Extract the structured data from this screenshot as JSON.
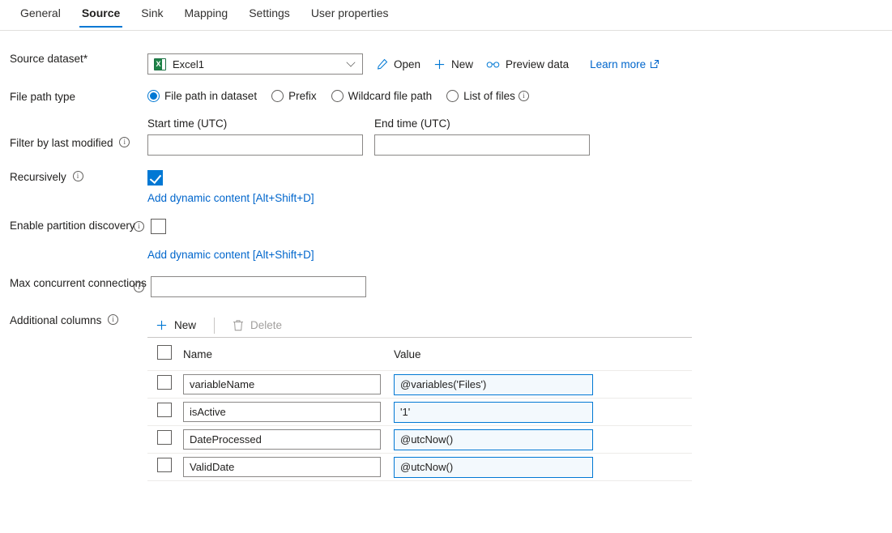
{
  "tabs": [
    {
      "label": "General",
      "active": false
    },
    {
      "label": "Source",
      "active": true
    },
    {
      "label": "Sink",
      "active": false
    },
    {
      "label": "Mapping",
      "active": false
    },
    {
      "label": "Settings",
      "active": false
    },
    {
      "label": "User properties",
      "active": false
    }
  ],
  "source_dataset": {
    "label": "Source dataset",
    "required_marker": "*",
    "value": "Excel1",
    "icon": "excel-icon",
    "commands": [
      {
        "label": "Open",
        "icon": "pencil-icon"
      },
      {
        "label": "New",
        "icon": "plus-icon"
      },
      {
        "label": "Preview data",
        "icon": "glasses-icon"
      }
    ],
    "learn_more": "Learn more"
  },
  "file_path_type": {
    "label": "File path type",
    "options": [
      {
        "label": "File path in dataset",
        "selected": true,
        "info": false
      },
      {
        "label": "Prefix",
        "selected": false,
        "info": false
      },
      {
        "label": "Wildcard file path",
        "selected": false,
        "info": false
      },
      {
        "label": "List of files",
        "selected": false,
        "info": true
      }
    ]
  },
  "filter_last_modified": {
    "label": "Filter by last modified",
    "start_label": "Start time (UTC)",
    "start_value": "",
    "end_label": "End time (UTC)",
    "end_value": ""
  },
  "recursively": {
    "label": "Recursively",
    "checked": true,
    "dynamic_link": "Add dynamic content [Alt+Shift+D]"
  },
  "partition_discovery": {
    "label": "Enable partition discovery",
    "checked": false,
    "dynamic_link": "Add dynamic content [Alt+Shift+D]"
  },
  "max_concurrent_connections": {
    "label": "Max concurrent connections",
    "value": ""
  },
  "additional_columns": {
    "label": "Additional columns",
    "new_label": "New",
    "delete_label": "Delete",
    "delete_disabled": true,
    "headers": {
      "name": "Name",
      "value": "Value"
    },
    "rows": [
      {
        "name": "variableName",
        "value": "@variables('Files')",
        "checked": false
      },
      {
        "name": "isActive",
        "value": "'1'",
        "checked": false
      },
      {
        "name": "DateProcessed",
        "value": "@utcNow()",
        "checked": false
      },
      {
        "name": "ValidDate",
        "value": "@utcNow()",
        "checked": false
      }
    ]
  },
  "colors": {
    "accent": "#0078d4",
    "link": "#0066cc",
    "excel_green": "#1d8247",
    "border": "#8a8886",
    "row_divider": "#edebe9"
  }
}
